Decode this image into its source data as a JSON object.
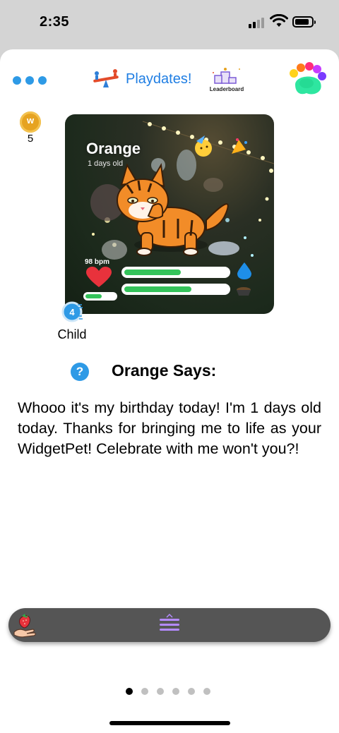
{
  "status_bar": {
    "time": "2:35",
    "signal_bars_active": 2,
    "battery_level": 0.8
  },
  "header": {
    "menu_icon": "more-dots-icon",
    "playdates_label": "Playdates!",
    "leaderboard_label": "Leaderboard",
    "paw_icon": "rainbow-paw-icon"
  },
  "coins": {
    "count": "5"
  },
  "pet": {
    "name": "Orange",
    "age": "1 days old",
    "heart_rate": "98 bpm",
    "hunger_level": 0.55,
    "happiness_level": 0.65,
    "energy_level": 0.55,
    "stage_number": "4",
    "stage_label": "Child"
  },
  "dialog": {
    "title": "Orange Says:",
    "help_icon": "?",
    "message": "Whooo it's my birthday today! I'm 1 days old today. Thanks for bringing me to life as your WidgetPet! Celebrate with me won't you?!"
  },
  "bottom_bar": {
    "left_icon": "hand-with-strawberry-icon",
    "center_icon": "menu-icon"
  },
  "pager": {
    "total_pages": 6,
    "active_page": 1
  },
  "colors": {
    "accent_blue": "#2e9ae6",
    "link_blue": "#1f7ee3",
    "bar_green": "#34c35a",
    "bottom_bar_gray": "#555555"
  }
}
